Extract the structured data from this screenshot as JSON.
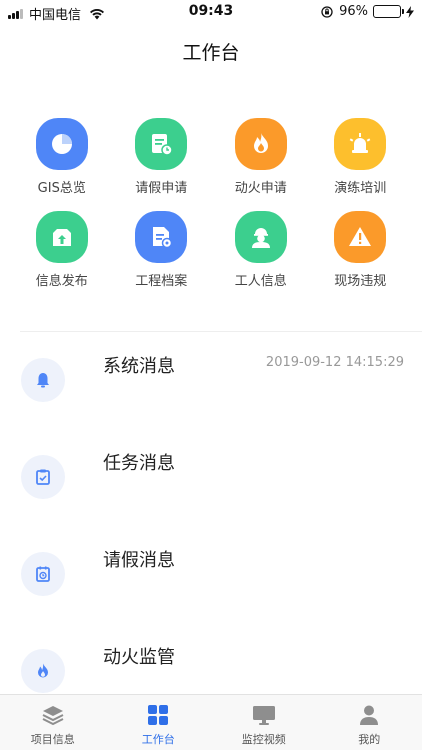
{
  "status_bar": {
    "carrier": "中国电信",
    "time": "09:43",
    "battery": "96%",
    "battery_level": 0.96
  },
  "header": {
    "title": "工作台"
  },
  "grid": [
    {
      "label": "GIS总览",
      "icon": "pie-chart-icon",
      "color": "#4f86f7"
    },
    {
      "label": "请假申请",
      "icon": "leave-form-icon",
      "color": "#3ccf8e"
    },
    {
      "label": "动火申请",
      "icon": "fire-icon",
      "color": "#fb9a2a"
    },
    {
      "label": "演练培训",
      "icon": "alarm-light-icon",
      "color": "#fdbf2d"
    },
    {
      "label": "信息发布",
      "icon": "publish-icon",
      "color": "#3ccf8e"
    },
    {
      "label": "工程档案",
      "icon": "archive-icon",
      "color": "#4f86f7"
    },
    {
      "label": "工人信息",
      "icon": "worker-icon",
      "color": "#3ccf8e"
    },
    {
      "label": "现场违规",
      "icon": "warning-icon",
      "color": "#fb9a2a"
    }
  ],
  "messages": [
    {
      "title": "系统消息",
      "time": "2019-09-12 14:15:29",
      "icon": "bell-icon"
    },
    {
      "title": "任务消息",
      "time": "",
      "icon": "clipboard-check-icon"
    },
    {
      "title": "请假消息",
      "time": "",
      "icon": "calendar-clock-icon"
    },
    {
      "title": "动火监管",
      "time": "",
      "icon": "fire-icon"
    }
  ],
  "tabbar": [
    {
      "label": "项目信息",
      "icon": "layers-icon",
      "active": false
    },
    {
      "label": "工作台",
      "icon": "grid-icon",
      "active": true
    },
    {
      "label": "监控视频",
      "icon": "monitor-icon",
      "active": false
    },
    {
      "label": "我的",
      "icon": "user-icon",
      "active": false
    }
  ],
  "colors": {
    "accent": "#2f6fe8",
    "message_icon": "#4f86f7",
    "tab_inactive": "#8e8e8e"
  }
}
